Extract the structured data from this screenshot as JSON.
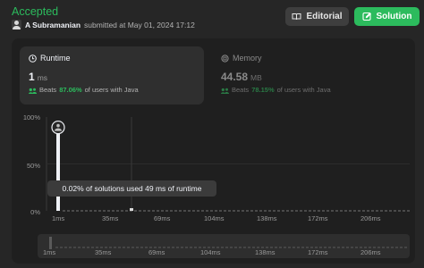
{
  "header": {
    "status": "Accepted",
    "author": "A Subramanian",
    "submitted_text": "submitted at May 01, 2024 17:12"
  },
  "buttons": {
    "editorial": "Editorial",
    "solution": "Solution"
  },
  "runtime": {
    "label": "Runtime",
    "value": "1",
    "unit": "ms",
    "beats_prefix": "Beats",
    "beats_pct": "87.06%",
    "beats_suffix": "of users with Java"
  },
  "memory": {
    "label": "Memory",
    "value": "44.58",
    "unit": "MB",
    "beats_prefix": "Beats",
    "beats_pct": "78.15%",
    "beats_suffix": "of users with Java"
  },
  "tooltip": "0.02% of solutions used 49 ms of runtime",
  "colors": {
    "accent": "#2cbb5d",
    "background": "#262626",
    "panel": "#1f1f1f"
  },
  "chart_data": {
    "type": "bar",
    "y_ticks": [
      "100%",
      "50%",
      "0%"
    ],
    "x_ticks": [
      "1ms",
      "35ms",
      "69ms",
      "104ms",
      "138ms",
      "172ms",
      "206ms"
    ],
    "range_ticks": [
      "1ms",
      "35ms",
      "69ms",
      "104ms",
      "138ms",
      "172ms",
      "206ms"
    ],
    "ylim": [
      0,
      100
    ],
    "xlim": [
      1,
      206
    ],
    "bars": [
      {
        "x": 1,
        "value": 87.06,
        "highlight": true
      },
      {
        "x": 49,
        "value": 0.02,
        "highlight": false
      }
    ]
  }
}
